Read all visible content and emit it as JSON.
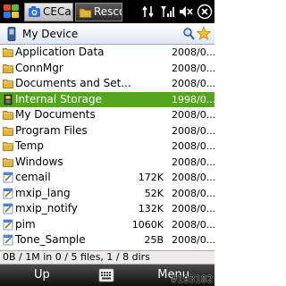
{
  "statusbar": {
    "tabs": [
      {
        "label": "CECap"
      },
      {
        "label": "Resco"
      }
    ],
    "icons": [
      "connectivity-icon",
      "signal-icon",
      "volume-icon",
      "close-icon"
    ]
  },
  "address": {
    "path": "My Device",
    "icons": [
      "device-icon",
      "search-icon",
      "favorite-star-icon"
    ]
  },
  "files": [
    {
      "name": "Application Data",
      "size": "",
      "date": "2008/0...",
      "kind": "folder"
    },
    {
      "name": "ConnMgr",
      "size": "",
      "date": "2008/0...",
      "kind": "folder"
    },
    {
      "name": "Documents and Set...",
      "size": "",
      "date": "2008/0...",
      "kind": "folder"
    },
    {
      "name": "Internal Storage",
      "size": "",
      "date": "1998/0...",
      "kind": "storage",
      "selected": true
    },
    {
      "name": "My Documents",
      "size": "",
      "date": "2008/0...",
      "kind": "folder"
    },
    {
      "name": "Program Files",
      "size": "",
      "date": "2008/0...",
      "kind": "folder"
    },
    {
      "name": "Temp",
      "size": "",
      "date": "2008/0...",
      "kind": "folder"
    },
    {
      "name": "Windows",
      "size": "",
      "date": "2008/0...",
      "kind": "folder"
    },
    {
      "name": "cemail",
      "size": "172K",
      "date": "2008/0...",
      "kind": "file"
    },
    {
      "name": "mxip_lang",
      "size": "52K",
      "date": "2008/0...",
      "kind": "file"
    },
    {
      "name": "mxip_notify",
      "size": "132K",
      "date": "2008/0...",
      "kind": "file"
    },
    {
      "name": "pim",
      "size": "1060K",
      "date": "2008/0...",
      "kind": "file"
    },
    {
      "name": "Tone_Sample",
      "size": "25B",
      "date": "2008/0...",
      "kind": "file"
    }
  ],
  "info": "0B / 1M in 0 / 5 files, 1 / 8 dirs",
  "softkeys": {
    "left": "Up",
    "right": "Menu",
    "middle_icon": "keyboard-icon"
  },
  "watermark": "#193102",
  "colors": {
    "selection": "#53a51d",
    "folder": "#e2b43a",
    "statusbar": "#000000"
  }
}
